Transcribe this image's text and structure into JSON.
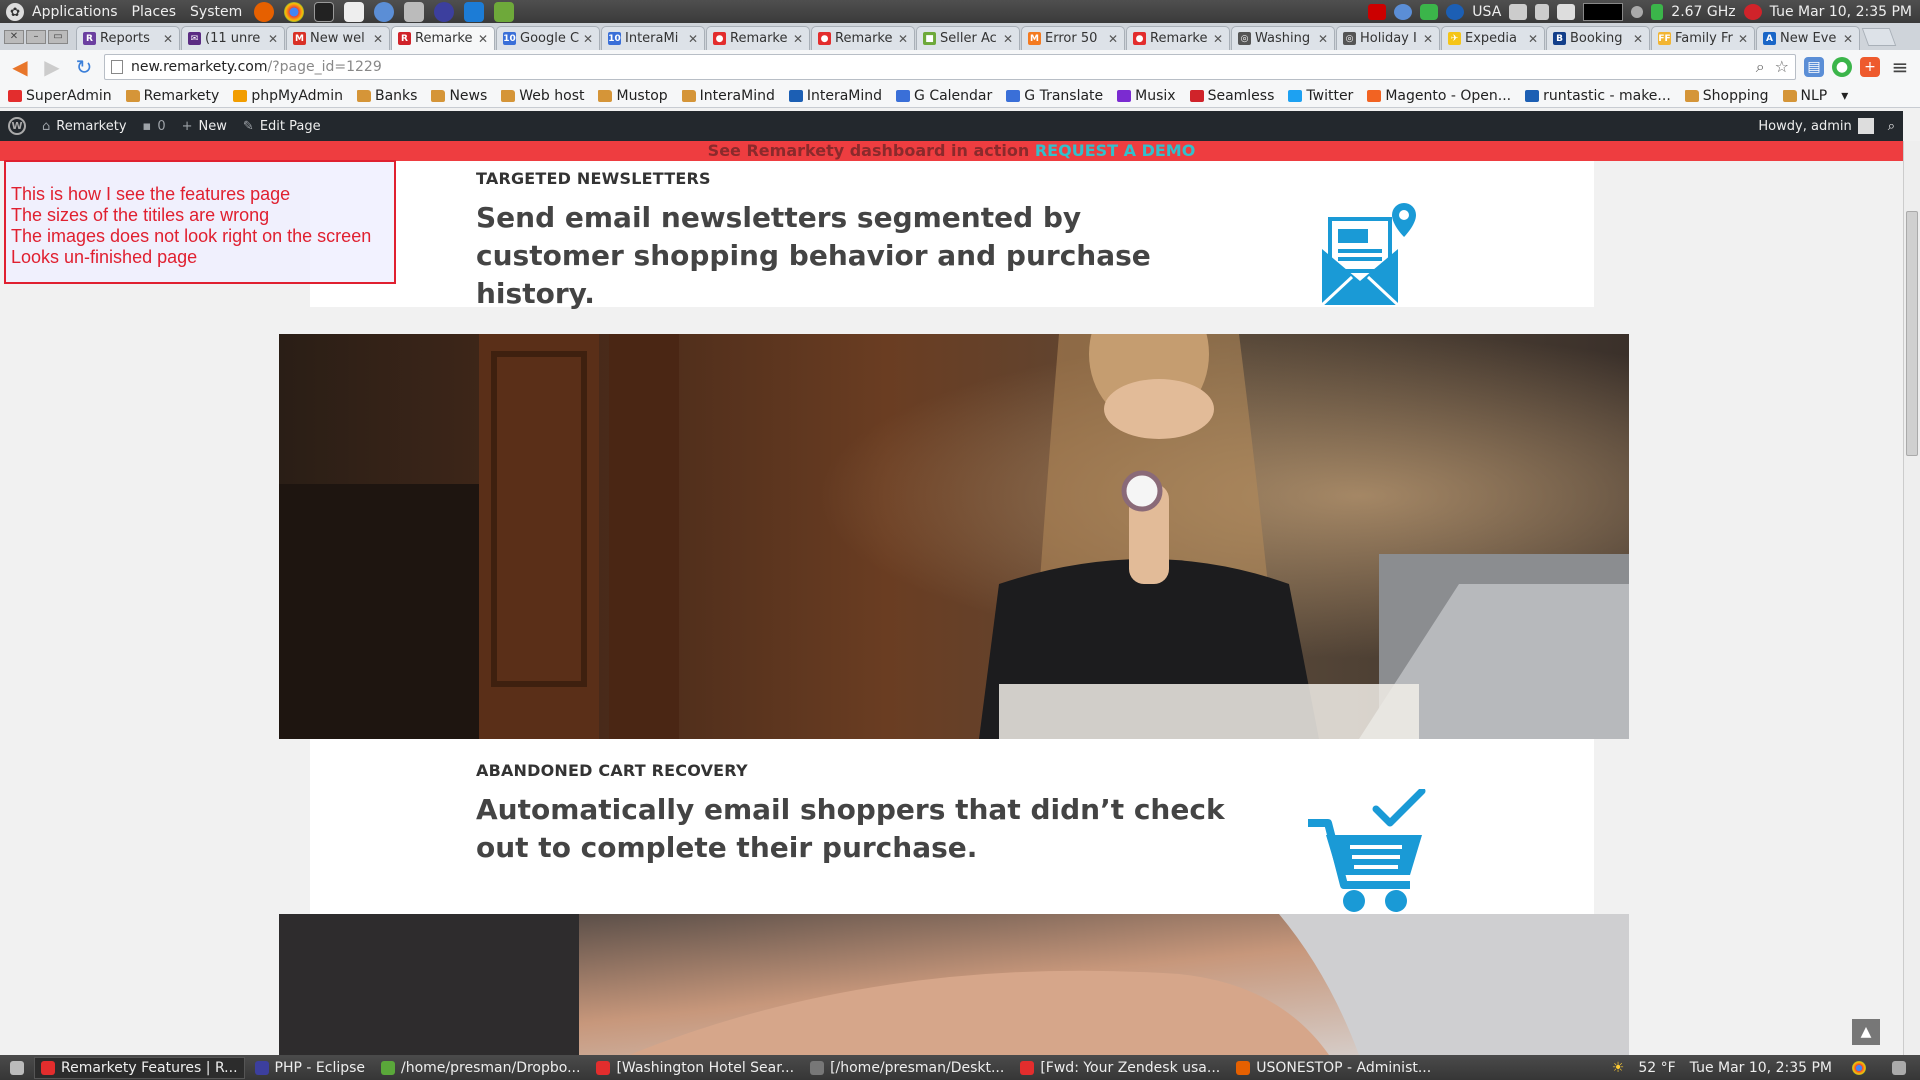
{
  "gnome_panel": {
    "menus": [
      "Applications",
      "Places",
      "System"
    ],
    "tray": {
      "kb_layout": "USA",
      "cpu_freq": "2.67 GHz",
      "clock": "Tue Mar 10,  2:35 PM"
    }
  },
  "tabs": [
    {
      "title": "Reports",
      "favicon_color": "#6b3fa0",
      "favicon_text": "R"
    },
    {
      "title": "(11 unre",
      "favicon_color": "#5b2c83",
      "favicon_text": "✉"
    },
    {
      "title": "New wel",
      "favicon_color": "#d93025",
      "favicon_text": "M"
    },
    {
      "title": "Remarke",
      "favicon_color": "#d0232a",
      "favicon_text": "R",
      "active": true
    },
    {
      "title": "Google C",
      "favicon_color": "#3a6fd8",
      "favicon_text": "10"
    },
    {
      "title": "InteraMi",
      "favicon_color": "#3a6fd8",
      "favicon_text": "10"
    },
    {
      "title": "Remarke",
      "favicon_color": "#e32d2d",
      "favicon_text": "●"
    },
    {
      "title": "Remarke",
      "favicon_color": "#e32d2d",
      "favicon_text": "●"
    },
    {
      "title": "Seller Ac",
      "favicon_color": "#6ea93a",
      "favicon_text": "■"
    },
    {
      "title": "Error 50",
      "favicon_color": "#f47a20",
      "favicon_text": "M"
    },
    {
      "title": "Remarke",
      "favicon_color": "#e32d2d",
      "favicon_text": "●"
    },
    {
      "title": "Washing",
      "favicon_color": "#555555",
      "favicon_text": "◎"
    },
    {
      "title": "Holiday I",
      "favicon_color": "#555555",
      "favicon_text": "◎"
    },
    {
      "title": "Expedia",
      "favicon_color": "#f5c518",
      "favicon_text": "✈"
    },
    {
      "title": "Booking",
      "favicon_color": "#123e8a",
      "favicon_text": "B"
    },
    {
      "title": "Family Fr",
      "favicon_color": "#f2b533",
      "favicon_text": "FF"
    },
    {
      "title": "New Eve",
      "favicon_color": "#1a66c7",
      "favicon_text": "A"
    }
  ],
  "toolbar": {
    "url_host": "new.remarkety.com",
    "url_path": "/?page_id=1229"
  },
  "bookmarks": [
    {
      "label": "SuperAdmin",
      "icon": "remarkety-icon",
      "color": "#e32d2d"
    },
    {
      "label": "Remarkety",
      "icon": "folder-icon",
      "color": "#d59538"
    },
    {
      "label": "phpMyAdmin",
      "icon": "pma-icon",
      "color": "#f29d00"
    },
    {
      "label": "Banks",
      "icon": "folder-icon",
      "color": "#d59538"
    },
    {
      "label": "News",
      "icon": "folder-icon",
      "color": "#d59538"
    },
    {
      "label": "Web host",
      "icon": "folder-icon",
      "color": "#d59538"
    },
    {
      "label": "Mustop",
      "icon": "folder-icon",
      "color": "#d59538"
    },
    {
      "label": "InteraMind",
      "icon": "folder-icon",
      "color": "#d59538"
    },
    {
      "label": "InteraMind",
      "icon": "interamind-icon",
      "color": "#1c5fb4"
    },
    {
      "label": "G Calendar",
      "icon": "calendar-icon",
      "color": "#3a6fd8"
    },
    {
      "label": "G Translate",
      "icon": "translate-icon",
      "color": "#3a6fd8"
    },
    {
      "label": "Musix",
      "icon": "musix-icon",
      "color": "#7b2bd1"
    },
    {
      "label": "Seamless",
      "icon": "seamless-icon",
      "color": "#d0232a"
    },
    {
      "label": "Twitter",
      "icon": "twitter-icon",
      "color": "#1da1f2"
    },
    {
      "label": "Magento - Open...",
      "icon": "magento-icon",
      "color": "#f26322"
    },
    {
      "label": "runtastic - make...",
      "icon": "runtastic-icon",
      "color": "#1c5fb4"
    },
    {
      "label": "Shopping",
      "icon": "folder-icon",
      "color": "#d59538"
    },
    {
      "label": "NLP",
      "icon": "folder-icon",
      "color": "#d59538"
    }
  ],
  "wp_admin_bar": {
    "site_name": "Remarkety",
    "comments_count": "0",
    "new_label": "New",
    "edit_label": "Edit Page",
    "howdy": "Howdy, admin"
  },
  "promo_bar": {
    "text": "See Remarkety dashboard in action",
    "cta": "REQUEST A DEMO"
  },
  "features": [
    {
      "label": "TARGETED NEWSLETTERS",
      "heading": "Send email newsletters segmented by customer shopping behavior and purchase history.",
      "icon": "newsletter-envelope-icon"
    },
    {
      "label": "ABANDONED CART RECOVERY",
      "heading": "Automatically email shoppers that didn’t check out to complete their purchase.",
      "icon": "shopping-cart-check-icon"
    }
  ],
  "annotation": {
    "lines": [
      "This is how I see the features page",
      "The sizes of the titiles are wrong",
      "The images does not look right on the screen",
      "Looks un-finished page"
    ]
  },
  "taskbar": {
    "tasks": [
      {
        "label": "Remarkety Features | R...",
        "color": "#e32d2d",
        "active": true
      },
      {
        "label": "PHP - Eclipse",
        "color": "#3c3f9e"
      },
      {
        "label": "/home/presman/Dropbo...",
        "color": "#5aa83a"
      },
      {
        "label": "[Washington Hotel Sear...",
        "color": "#e32d2d"
      },
      {
        "label": "[/home/presman/Deskt...",
        "color": "#777777"
      },
      {
        "label": "[Fwd: Your Zendesk usa...",
        "color": "#e32d2d"
      },
      {
        "label": "USONESTOP - Administ...",
        "color": "#e66000"
      }
    ],
    "weather": "52 °F",
    "clock": "Tue Mar 10,  2:35 PM"
  },
  "colors": {
    "promo_red": "#ee3d40",
    "cta_teal": "#32c0cc",
    "icon_blue": "#1a9ad6",
    "annotation_red": "#e02030"
  }
}
